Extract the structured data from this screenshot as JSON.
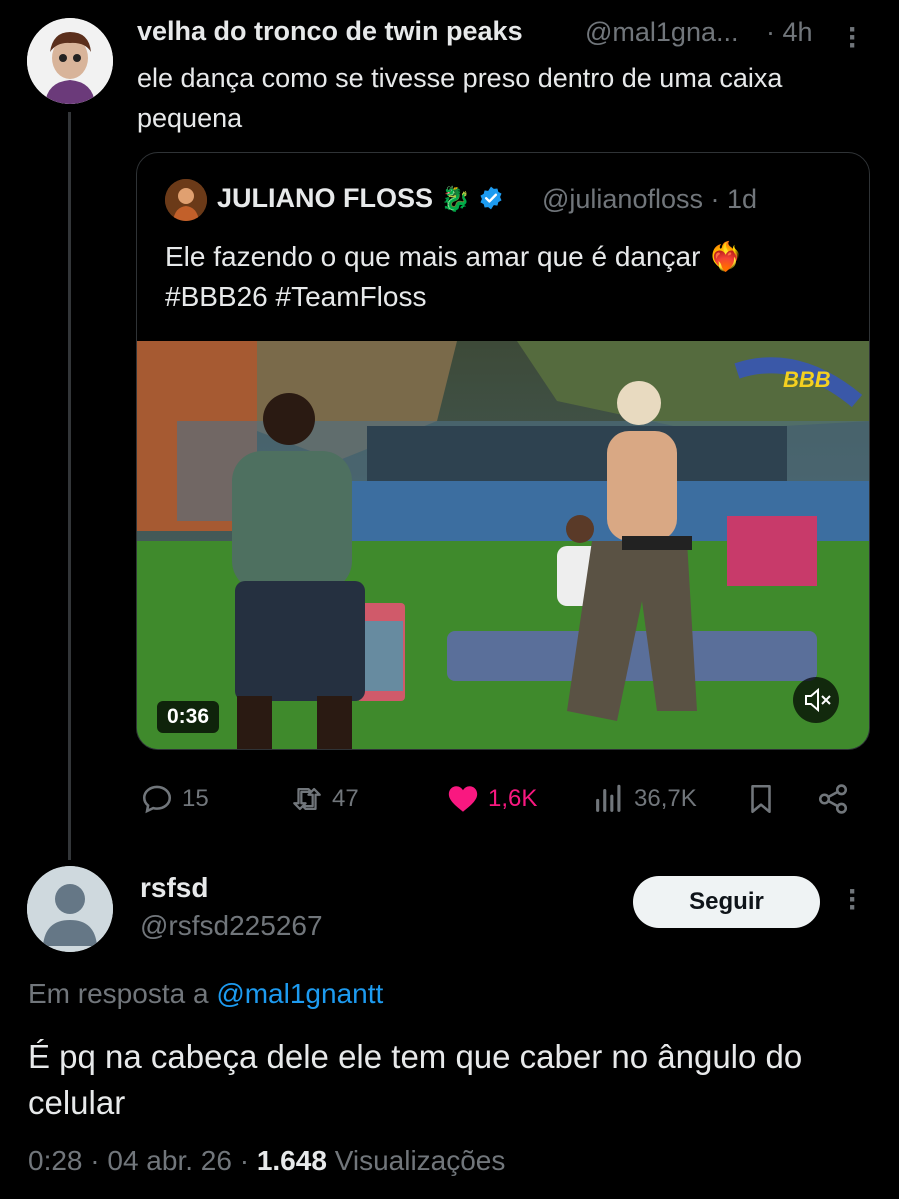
{
  "thread_reply": {
    "author_name": "velha do tronco de twin peaks",
    "author_handle": "@mal1gna...",
    "time": "· 4h",
    "text": "ele dança como se tivesse preso dentro de uma caixa pequena"
  },
  "quoted_tweet": {
    "author_name": "JULIANO FLOSS",
    "author_emoji": "🐉",
    "verified": true,
    "author_handle": "@julianofloss · 1d",
    "text_line1": "Ele fazendo o que mais amar que é dançar",
    "text_emoji": "❤️‍🔥",
    "text_line2": "#BBB26 #TeamFloss",
    "video_duration": "0:36",
    "video_watermark": "BBB"
  },
  "actions": {
    "replies": "15",
    "reposts": "47",
    "likes": "1,6K",
    "views": "36,7K"
  },
  "main_tweet": {
    "author_name": "rsfsd",
    "author_handle": "@rsfsd225267",
    "follow_label": "Seguir",
    "reply_prefix": "Em resposta a",
    "reply_to": "@mal1gnantt",
    "text": "É pq na cabeça dele ele tem que caber no ângulo do celular",
    "time": "0:28 · 04 abr. 26 ·",
    "views_count": "1.648",
    "views_label": "Visualizações"
  },
  "colors": {
    "background": "#000000",
    "text": "#e7e9ea",
    "muted": "#71767b",
    "link": "#1d9bf0",
    "like": "#f91880",
    "verified": "#1d9bf0"
  },
  "icons": [
    "reply-icon",
    "repost-icon",
    "heart-icon",
    "views-icon",
    "bookmark-icon",
    "share-icon",
    "more-icon",
    "mute-icon",
    "verified-icon"
  ]
}
